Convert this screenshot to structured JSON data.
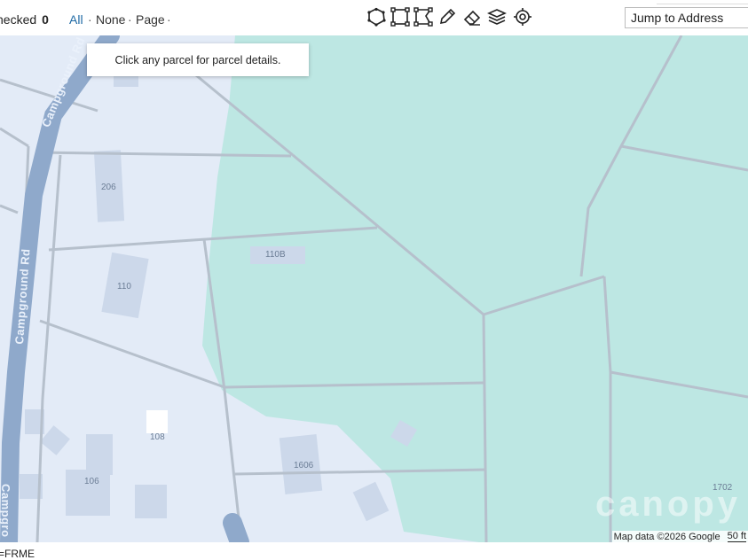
{
  "toolbar": {
    "checked_label": "hecked",
    "checked_count": "0",
    "select_all": "All",
    "select_none": "None",
    "select_page": "Page",
    "separator": "·",
    "jump_placeholder": "Jump to Address",
    "tools": [
      "polygon-select-icon",
      "rectangle-select-icon",
      "lasso-select-icon",
      "pencil-draw-icon",
      "eraser-icon",
      "layers-icon",
      "locate-target-icon"
    ]
  },
  "map": {
    "tooltip": "Click any parcel for parcel details.",
    "road_name_1": "Campground Rd",
    "road_name_2": "Campground Rd",
    "road_name_3": "Campgro",
    "parcels": [
      "206",
      "110B",
      "110",
      "108",
      "106",
      "1606",
      "1702"
    ],
    "attribution": "Map data ©2026 Google",
    "scale": "50 ft",
    "watermark": "canopy",
    "colors": {
      "residential": "#e3ebf7",
      "green_area": "#bde7e3",
      "road": "#8fa9cb",
      "parcel_line": "#b6c0cc"
    }
  },
  "footer": {
    "text": "=FRME"
  }
}
